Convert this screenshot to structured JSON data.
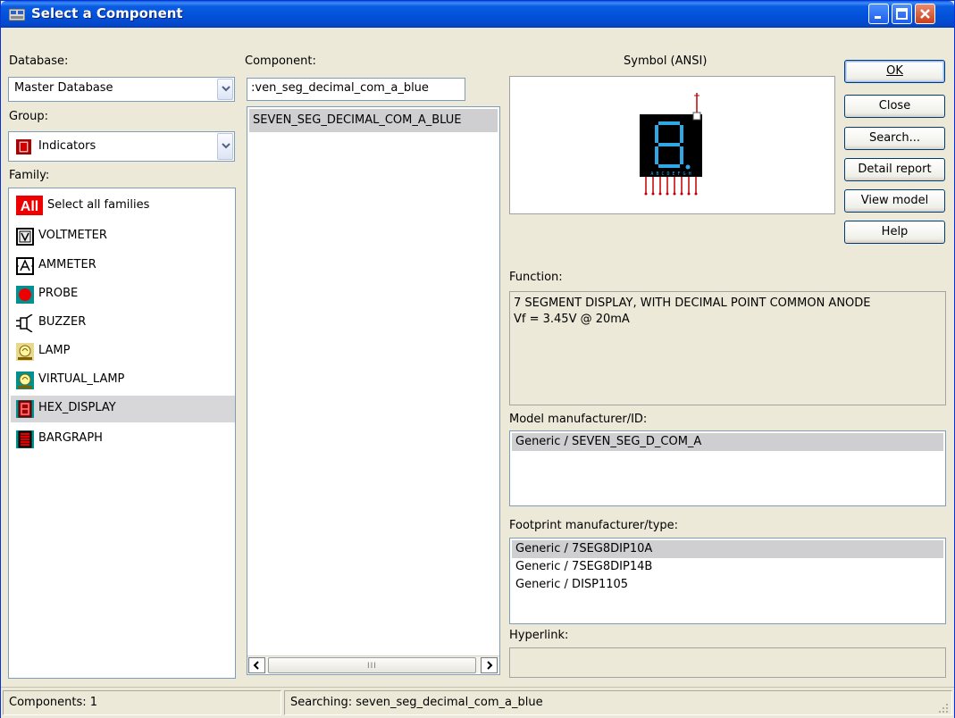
{
  "window": {
    "title": "Select a Component",
    "minimize_label": "Minimize",
    "maximize_label": "Maximize",
    "close_label": "Close window"
  },
  "database": {
    "label": "Database:",
    "selected": "Master Database"
  },
  "group": {
    "label": "Group:",
    "selected": "Indicators"
  },
  "family": {
    "label": "Family:",
    "items": [
      {
        "label": "Select all families",
        "icon": "all-families-icon"
      },
      {
        "label": "VOLTMETER",
        "icon": "voltmeter-icon"
      },
      {
        "label": "AMMETER",
        "icon": "ammeter-icon"
      },
      {
        "label": "PROBE",
        "icon": "probe-icon"
      },
      {
        "label": "BUZZER",
        "icon": "buzzer-icon"
      },
      {
        "label": "LAMP",
        "icon": "lamp-icon"
      },
      {
        "label": "VIRTUAL_LAMP",
        "icon": "virtual-lamp-icon"
      },
      {
        "label": "HEX_DISPLAY",
        "icon": "hex-display-icon"
      },
      {
        "label": "BARGRAPH",
        "icon": "bargraph-icon"
      }
    ],
    "selected_index": 7,
    "all_icon_text": "All"
  },
  "component": {
    "label": "Component:",
    "search_value": ":ven_seg_decimal_com_a_blue",
    "items": [
      "SEVEN_SEG_DECIMAL_COM_A_BLUE"
    ],
    "scroll_grip": "III"
  },
  "symbol": {
    "label": "Symbol (ANSI)",
    "pin_text": "A B C D E F G H"
  },
  "buttons": {
    "ok": "OK",
    "close": "Close",
    "search": "Search...",
    "detail_report": "Detail report",
    "view_model": "View model",
    "help": "Help"
  },
  "function": {
    "label": "Function:",
    "text": "7 SEGMENT DISPLAY, WITH DECIMAL POINT COMMON ANODE\nVf = 3.45V @ 20mA"
  },
  "model": {
    "label": "Model manufacturer/ID:",
    "items": [
      "Generic / SEVEN_SEG_D_COM_A"
    ]
  },
  "footprint": {
    "label": "Footprint manufacturer/type:",
    "items": [
      "Generic / 7SEG8DIP10A",
      "Generic / 7SEG8DIP14B",
      "Generic / DISP1105"
    ]
  },
  "hyperlink": {
    "label": "Hyperlink:",
    "value": ""
  },
  "status": {
    "components": "Components: 1",
    "searching": "Searching: seven_seg_decimal_com_a_blue"
  },
  "colors": {
    "titlebar": "#0a5ce3",
    "selection": "#d7d7d9",
    "segment_blue": "#2fa8e6"
  }
}
